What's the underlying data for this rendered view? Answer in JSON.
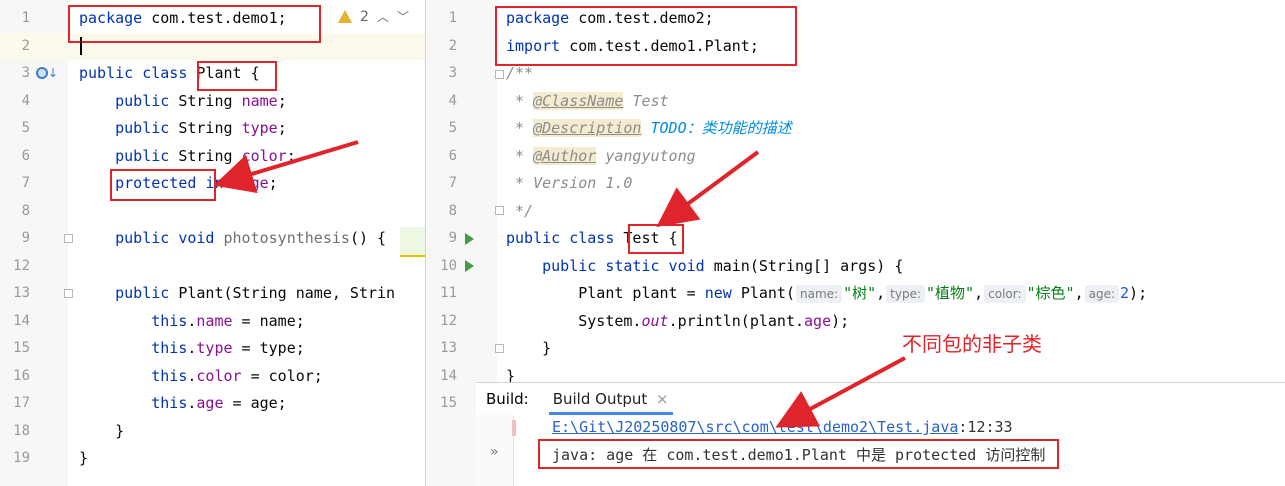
{
  "left_editor": {
    "warnings_count": "2",
    "lines": [
      {
        "n": "1",
        "html_parts": [
          [
            "kw",
            "package "
          ],
          [
            "",
            "com.test.demo1;"
          ]
        ]
      },
      {
        "n": "2",
        "html_parts": []
      },
      {
        "n": "3",
        "html_parts": [
          [
            "kw",
            "public class "
          ],
          [
            "",
            "Plant {"
          ]
        ]
      },
      {
        "n": "4",
        "html_parts": [
          [
            "",
            "    "
          ],
          [
            "kw",
            "public "
          ],
          [
            "",
            "String "
          ],
          [
            "fld",
            "name"
          ],
          [
            "",
            ";"
          ]
        ]
      },
      {
        "n": "5",
        "html_parts": [
          [
            "",
            "    "
          ],
          [
            "kw",
            "public "
          ],
          [
            "",
            "String "
          ],
          [
            "fld",
            "type"
          ],
          [
            "",
            ";"
          ]
        ]
      },
      {
        "n": "6",
        "html_parts": [
          [
            "",
            "    "
          ],
          [
            "kw",
            "public "
          ],
          [
            "",
            "String "
          ],
          [
            "fld",
            "color"
          ],
          [
            "",
            ";"
          ]
        ]
      },
      {
        "n": "7",
        "html_parts": [
          [
            "",
            "    "
          ],
          [
            "kw",
            "protected "
          ],
          [
            "kw",
            "int "
          ],
          [
            "fld",
            "age"
          ],
          [
            "",
            ";"
          ]
        ]
      },
      {
        "n": "8",
        "html_parts": []
      },
      {
        "n": "9",
        "html_parts": [
          [
            "",
            "    "
          ],
          [
            "kw",
            "public void "
          ],
          [
            "fn-dim",
            "photosynthesis"
          ],
          [
            "",
            "() { "
          ]
        ]
      },
      {
        "n": "12",
        "html_parts": []
      },
      {
        "n": "13",
        "html_parts": [
          [
            "",
            "    "
          ],
          [
            "kw",
            "public "
          ],
          [
            "",
            "Plant(String name, Strin"
          ]
        ]
      },
      {
        "n": "14",
        "html_parts": [
          [
            "",
            "        "
          ],
          [
            "kw",
            "this"
          ],
          [
            "",
            "."
          ],
          [
            "fld",
            "name"
          ],
          [
            "",
            " = name;"
          ]
        ]
      },
      {
        "n": "15",
        "html_parts": [
          [
            "",
            "        "
          ],
          [
            "kw",
            "this"
          ],
          [
            "",
            "."
          ],
          [
            "fld",
            "type"
          ],
          [
            "",
            " = type;"
          ]
        ]
      },
      {
        "n": "16",
        "html_parts": [
          [
            "",
            "        "
          ],
          [
            "kw",
            "this"
          ],
          [
            "",
            "."
          ],
          [
            "fld",
            "color"
          ],
          [
            "",
            " = color;"
          ]
        ]
      },
      {
        "n": "17",
        "html_parts": [
          [
            "",
            "        "
          ],
          [
            "kw",
            "this"
          ],
          [
            "",
            "."
          ],
          [
            "fld",
            "age"
          ],
          [
            "",
            " = age;"
          ]
        ]
      },
      {
        "n": "18",
        "html_parts": [
          [
            "",
            "    }"
          ]
        ]
      },
      {
        "n": "19",
        "html_parts": [
          [
            "",
            "}"
          ]
        ]
      }
    ]
  },
  "right_editor": {
    "lines": [
      {
        "n": "1",
        "html_parts": [
          [
            "kw",
            "package "
          ],
          [
            "",
            "com.test.demo2;"
          ]
        ]
      },
      {
        "n": "2",
        "html_parts": [
          [
            "kw",
            "import "
          ],
          [
            "",
            "com.test.demo1.Plant;"
          ]
        ]
      },
      {
        "n": "3",
        "html_parts": [
          [
            "cmt",
            "/**"
          ]
        ]
      },
      {
        "n": "4",
        "html_parts": [
          [
            "cmt",
            " * "
          ],
          [
            "doc-tag",
            "@ClassName"
          ],
          [
            "cmt",
            " Test"
          ]
        ]
      },
      {
        "n": "5",
        "html_parts": [
          [
            "cmt",
            " * "
          ],
          [
            "doc-tag",
            "@Description"
          ],
          [
            "cmt",
            " "
          ],
          [
            "todo",
            "TODO：类功能的描述"
          ]
        ]
      },
      {
        "n": "6",
        "html_parts": [
          [
            "cmt",
            " * "
          ],
          [
            "doc-tag",
            "@Author"
          ],
          [
            "cmt",
            " yangyutong"
          ]
        ]
      },
      {
        "n": "7",
        "html_parts": [
          [
            "cmt",
            " * Version 1.0"
          ]
        ]
      },
      {
        "n": "8",
        "html_parts": [
          [
            "cmt",
            " */"
          ]
        ]
      },
      {
        "n": "9",
        "html_parts": [
          [
            "kw",
            "public class "
          ],
          [
            "",
            "Test {"
          ]
        ]
      },
      {
        "n": "10",
        "html_parts": [
          [
            "",
            "    "
          ],
          [
            "kw",
            "public static void "
          ],
          [
            "",
            "main(String[] args) {"
          ]
        ]
      },
      {
        "n": "11",
        "html_parts": [
          [
            "",
            "        Plant plant = "
          ],
          [
            "kw",
            "new "
          ],
          [
            "",
            "Plant("
          ],
          [
            "hint",
            "name:"
          ],
          [
            "str",
            "\"树\""
          ],
          [
            "",
            ","
          ],
          [
            "hint",
            "type:"
          ],
          [
            "str",
            "\"植物\""
          ],
          [
            "",
            ","
          ],
          [
            "hint",
            "color:"
          ],
          [
            "str",
            "\"棕色\""
          ],
          [
            "",
            ","
          ],
          [
            "hint",
            "age:"
          ],
          [
            "num",
            "2"
          ],
          [
            "",
            ");"
          ]
        ]
      },
      {
        "n": "12",
        "html_parts": [
          [
            "",
            "        System."
          ],
          [
            "fld ital",
            "out"
          ],
          [
            "",
            ".println(plant."
          ],
          [
            "fld",
            "age"
          ],
          [
            "",
            ");"
          ]
        ]
      },
      {
        "n": "13",
        "html_parts": [
          [
            "",
            "    }"
          ]
        ]
      },
      {
        "n": "14",
        "html_parts": [
          [
            "",
            "}"
          ]
        ]
      },
      {
        "n": "15",
        "html_parts": []
      }
    ]
  },
  "build": {
    "label": "Build:",
    "tab": "Build Output",
    "close": "×",
    "expand": "»",
    "path_link": "E:\\Git\\J20250807\\src\\com\\test\\demo2\\Test.java",
    "path_pos": ":12:33",
    "error": "java: age 在 com.test.demo1.Plant 中是 protected 访问控制"
  },
  "annotation": "不同包的非子类"
}
